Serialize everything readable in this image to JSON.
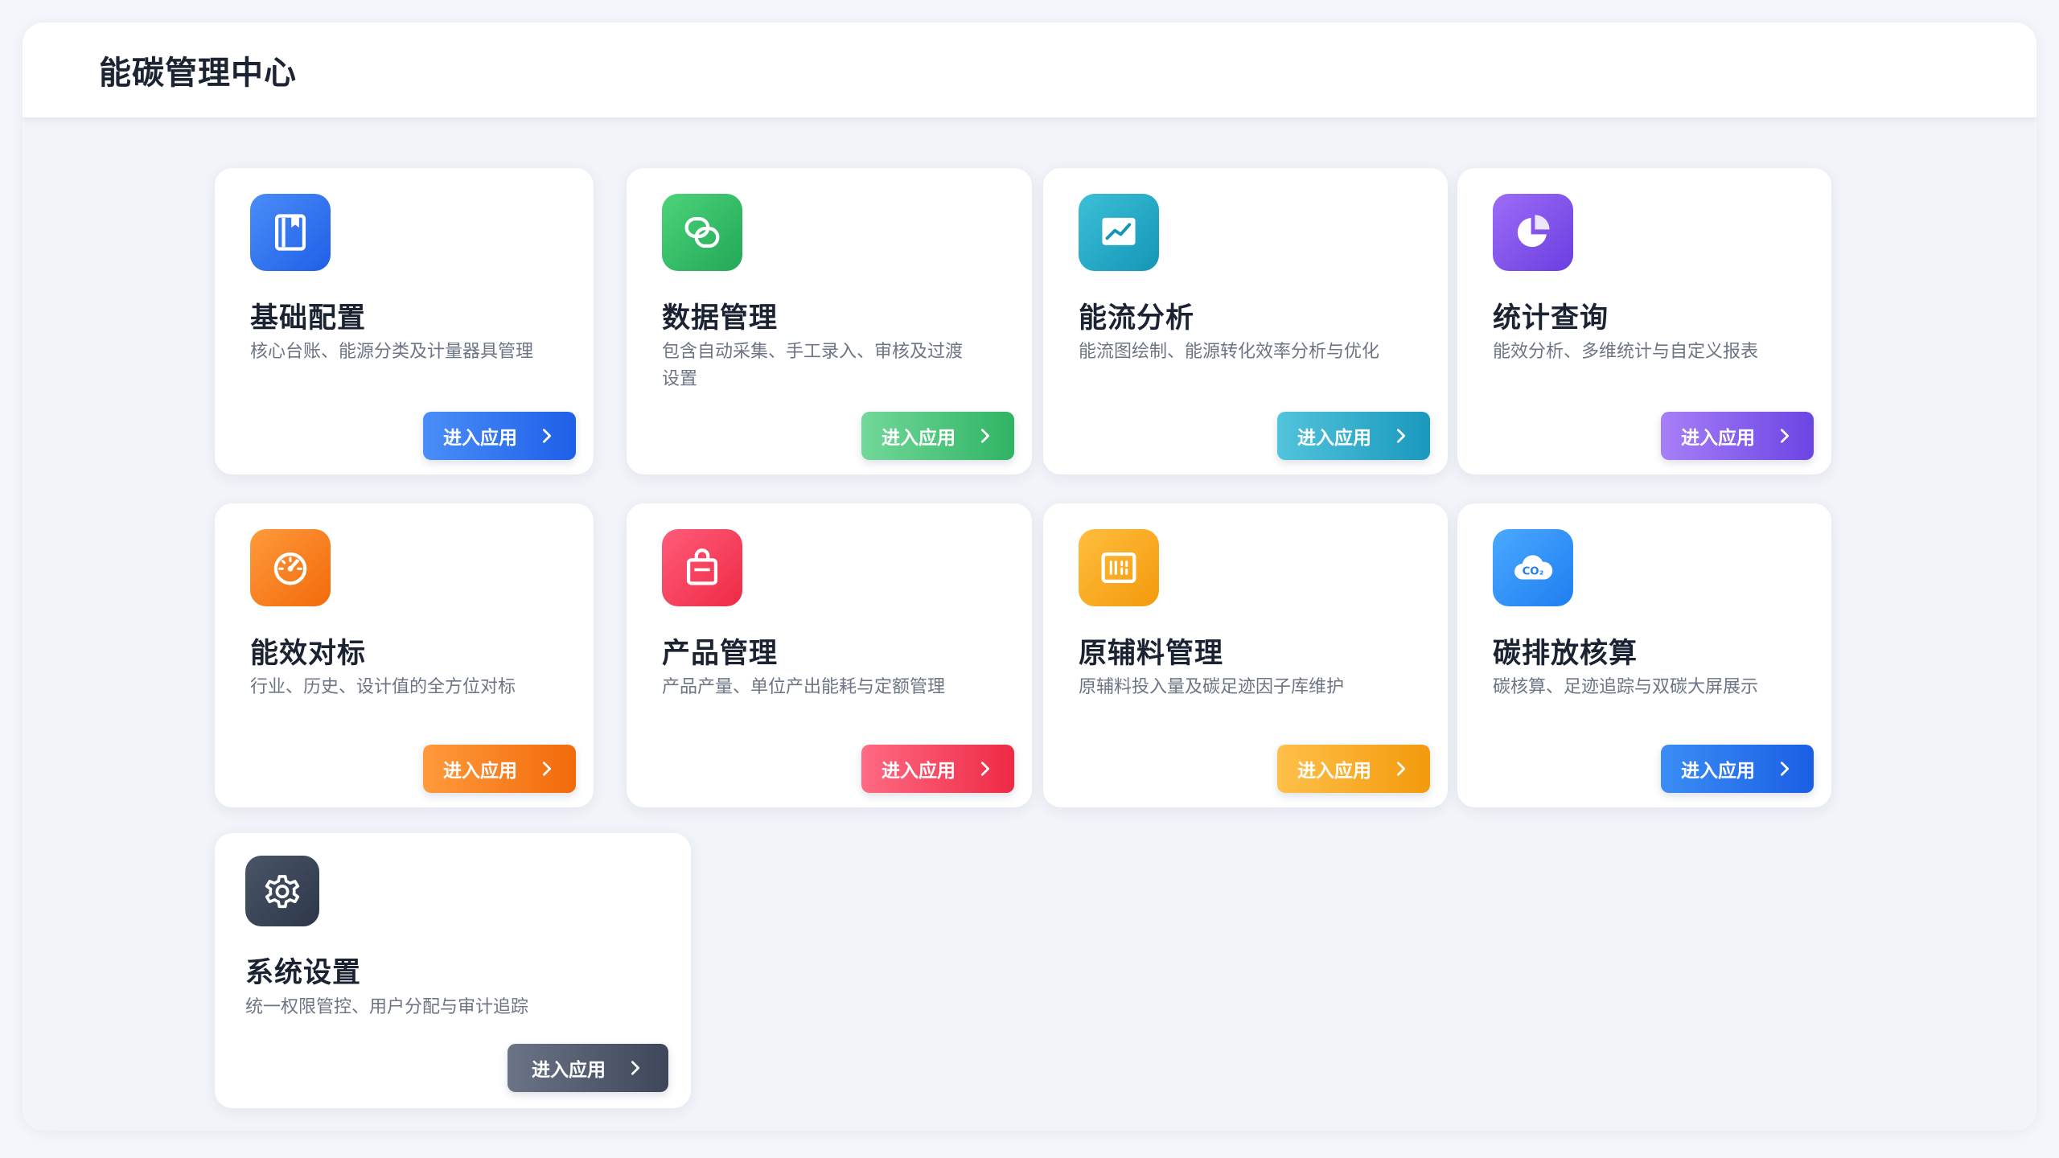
{
  "header": {
    "title": "能碳管理中心"
  },
  "enter_label": "进入应用",
  "cards": [
    {
      "title": "基础配置",
      "desc": "核心台账、能源分类及计量器具管理",
      "icon": "ledger-book-icon",
      "color": "#1f5fe6"
    },
    {
      "title": "数据管理",
      "desc": "包含自动采集、手工录入、审核及过渡设置",
      "icon": "link-icon",
      "color": "#22a857"
    },
    {
      "title": "能流分析",
      "desc": "能流图绘制、能源转化效率分析与优化",
      "icon": "trend-chart-icon",
      "color": "#1496b6"
    },
    {
      "title": "统计查询",
      "desc": "能效分析、多维统计与自定义报表",
      "icon": "pie-chart-icon",
      "color": "#6a3fe0"
    },
    {
      "title": "能效对标",
      "desc": "行业、历史、设计值的全方位对标",
      "icon": "speedometer-icon",
      "color": "#f26a0a"
    },
    {
      "title": "产品管理",
      "desc": "产品产量、单位产出能耗与定额管理",
      "icon": "shopping-bag-icon",
      "color": "#ee2a45"
    },
    {
      "title": "原辅料管理",
      "desc": "原辅料投入量及碳足迹因子库维护",
      "icon": "material-panel-icon",
      "color": "#f39a0d"
    },
    {
      "title": "碳排放核算",
      "desc": "碳核算、足迹追踪与双碳大屏展示",
      "icon": "co2-cloud-icon",
      "color": "#1f7ef0"
    },
    {
      "title": "系统设置",
      "desc": "统一权限管控、用户分配与审计追踪",
      "icon": "gear-icon",
      "color": "#2d3748"
    }
  ]
}
